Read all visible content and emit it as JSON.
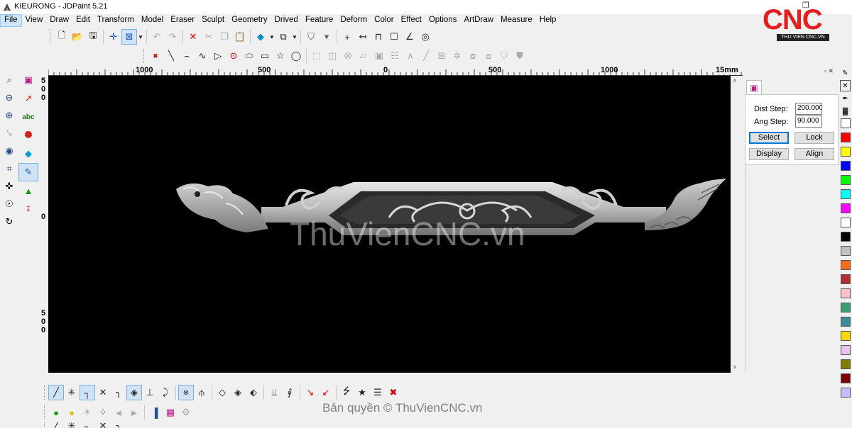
{
  "window": {
    "title": "KIEURONG - JDPaint 5.21"
  },
  "menu": [
    "File",
    "View",
    "Draw",
    "Edit",
    "Transform",
    "Model",
    "Eraser",
    "Sculpt",
    "Geometry",
    "Drived",
    "Feature",
    "Deform",
    "Color",
    "Effect",
    "Options",
    "ArtDraw",
    "Measure",
    "Help"
  ],
  "logo": {
    "text": "CNC",
    "subtitle": "THU VIEN CNC.VN",
    "color": "#e41e1e"
  },
  "ruler": {
    "h_labels": [
      "1000",
      "500",
      "0",
      "500",
      "1000",
      "15mm"
    ],
    "v_labels_top": [
      "5",
      "0",
      "0"
    ],
    "v_label_mid": "0",
    "v_labels_bottom": [
      "5",
      "0",
      "0"
    ]
  },
  "canvas": {
    "background": "#000000",
    "watermark": "ThuVienCNC.vn"
  },
  "panel": {
    "dist_step_label": "Dist Step:",
    "dist_step_value": "200.000",
    "ang_step_label": "Ang Step:",
    "ang_step_value": "90.000",
    "select_label": "Select",
    "lock_label": "Lock",
    "display_label": "Display",
    "align_label": "Align"
  },
  "palette": [
    "#ffffff",
    "#ff0000",
    "#ffff00",
    "#0000ff",
    "#00ff00",
    "#00ffff",
    "#ff00ff",
    "#ffffff",
    "#000000",
    "#c0c0c0",
    "#ff6a1a",
    "#b03030",
    "#ffc0c8",
    "#3aa070",
    "#3a8a9a",
    "#ffd700",
    "#e8c0e8",
    "#808000",
    "#800000",
    "#c0c0ff"
  ],
  "footer": {
    "copyright": "Bản quyền © ThuVienCNC.vn"
  }
}
